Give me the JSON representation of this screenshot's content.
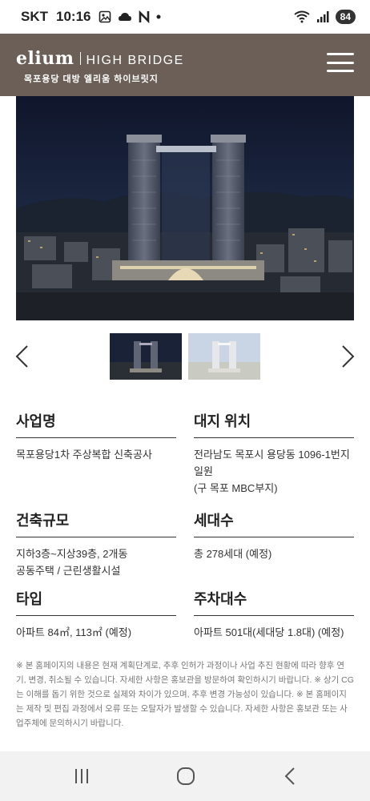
{
  "status_bar": {
    "carrier": "SKT",
    "time": "10:16",
    "battery": "84"
  },
  "header": {
    "brand_name": "elium",
    "brand_model": "HIGH BRIDGE",
    "subtitle": "목포용당 대방 엘리움 하이브릿지"
  },
  "info": {
    "project_name": {
      "title": "사업명",
      "text": "목포용당1차 주상복합 신축공사"
    },
    "site_location": {
      "title": "대지 위치",
      "text": "전라남도 목포시 용당동 1096-1번지 일원\n(구 목포 MBC부지)"
    },
    "building_scale": {
      "title": "건축규모",
      "text": "지하3층~지상39층, 2개동\n공동주택 / 근린생활시설"
    },
    "households": {
      "title": "세대수",
      "text": "총 278세대 (예정)"
    },
    "unit_type": {
      "title": "타입",
      "text": "아파트 84㎡, 113㎡ (예정)"
    },
    "parking": {
      "title": "주차대수",
      "text": "아파트 501대(세대당 1.8대) (예정)"
    }
  },
  "notice": "※ 본 홈페이지의 내용은 현재 계획단계로, 추후 인허가 과정이나 사업 추진 현황에 따라 향후 연기, 변경, 취소될 수 있습니다. 자세한 사항은 홍보관을 방문하여 확인하시기 바랍니다. ※ 상기 CG는 이해를 돕기 위한 것으로 실제와 차이가 있으며, 추후 변경 가능성이 있습니다. ※ 본 홈페이지는 제작 및 편집 과정에서 오류 또는 오탈자가 발생할 수 있습니다. 자세한 사항은 홍보관 또는 사업주체에 문의하시기 바랍니다.",
  "colors": {
    "header_bg": "#6b5f57",
    "night_sky": "#1a2238"
  },
  "icons": {
    "status": [
      "gallery-icon",
      "cloud-icon",
      "n-icon",
      "dot-icon",
      "wifi-icon",
      "signal-icon"
    ],
    "header": [
      "menu-icon"
    ],
    "gallery": [
      "chevron-left-icon",
      "chevron-right-icon"
    ],
    "bottom_nav": [
      "recent-apps-icon",
      "home-icon",
      "back-icon"
    ]
  }
}
